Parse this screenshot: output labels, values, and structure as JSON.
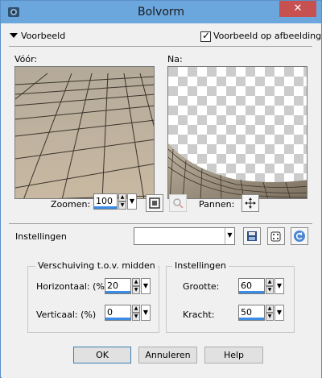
{
  "window": {
    "title": "Bolvorm",
    "close_glyph": "✕"
  },
  "preview_section": {
    "label": "Voorbeeld",
    "show_on_image_label": "Voorbeeld op afbeelding",
    "show_on_image_checked": true
  },
  "before_label": "Vóór:",
  "after_label": "Na:",
  "zoom": {
    "label": "Zoomen:",
    "value": "100"
  },
  "pan": {
    "label": "Pannen:"
  },
  "settings_bar": {
    "label": "Instellingen",
    "preset_value": ""
  },
  "offset_group": {
    "title": "Verschuiving t.o.v. midden",
    "horizontal_label": "Horizontaal: (%)",
    "horizontal_value": "20",
    "vertical_label": "Verticaal: (%)",
    "vertical_value": "0"
  },
  "settings_group": {
    "title": "Instellingen",
    "size_label": "Grootte:",
    "size_value": "60",
    "strength_label": "Kracht:",
    "strength_value": "50"
  },
  "buttons": {
    "ok": "OK",
    "cancel": "Annuleren",
    "help": "Help"
  },
  "colors": {
    "titlebar": "#6ba6dd",
    "close": "#c75050",
    "accent": "#3c8ce6"
  }
}
